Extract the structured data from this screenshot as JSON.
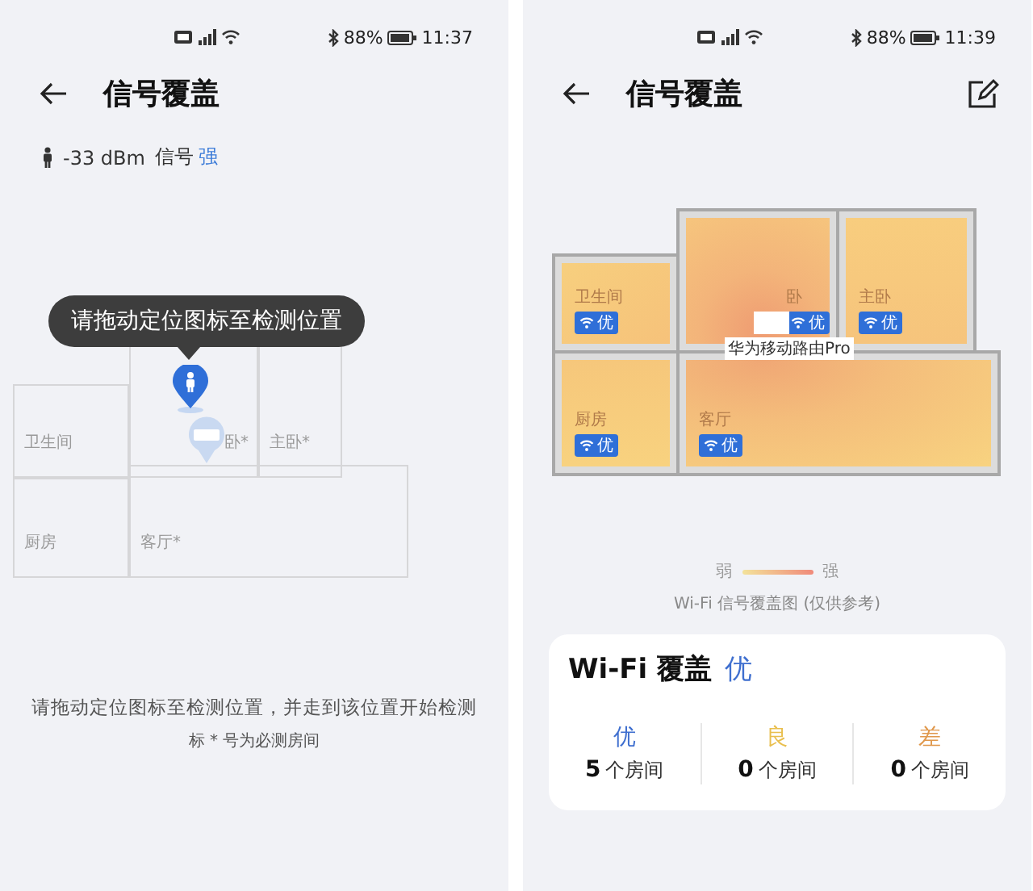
{
  "screens": [
    {
      "kind": "locate",
      "status_bar": {
        "battery": "88%",
        "time": "11:37"
      },
      "title": "信号覆盖",
      "signal": {
        "reading": "-33 dBm",
        "label": "信号",
        "strength": "强"
      },
      "tooltip": "请拖动定位图标至检测位置",
      "rooms": [
        {
          "name": "卫生间"
        },
        {
          "name": "卧*"
        },
        {
          "name": "主卧*"
        },
        {
          "name": "厨房"
        },
        {
          "name": "客厅*"
        }
      ],
      "hint": "请拖动定位图标至检测位置，并走到该位置开始检测",
      "note": "标 * 号为必测房间"
    },
    {
      "kind": "heatmap",
      "status_bar": {
        "battery": "88%",
        "time": "11:39"
      },
      "title": "信号覆盖",
      "rooms": [
        {
          "name": "卫生间",
          "grade": "优"
        },
        {
          "name": "卧",
          "grade": "优"
        },
        {
          "name": "主卧",
          "grade": "优"
        },
        {
          "name": "厨房",
          "grade": "优"
        },
        {
          "name": "客厅",
          "grade": "优"
        }
      ],
      "router": "华为移动路由Pro",
      "legend": {
        "weak": "弱",
        "strong": "强"
      },
      "caption": "Wi-Fi 信号覆盖图 (仅供参考)",
      "summary": {
        "title": "Wi-Fi 覆盖",
        "grade": "优",
        "stats": [
          {
            "grade": "优",
            "color": "#3f6fcf",
            "count": "5",
            "unit": "个房间"
          },
          {
            "grade": "良",
            "color": "#e9bf4e",
            "count": "0",
            "unit": "个房间"
          },
          {
            "grade": "差",
            "color": "#e0984c",
            "count": "0",
            "unit": "个房间"
          }
        ]
      }
    }
  ]
}
